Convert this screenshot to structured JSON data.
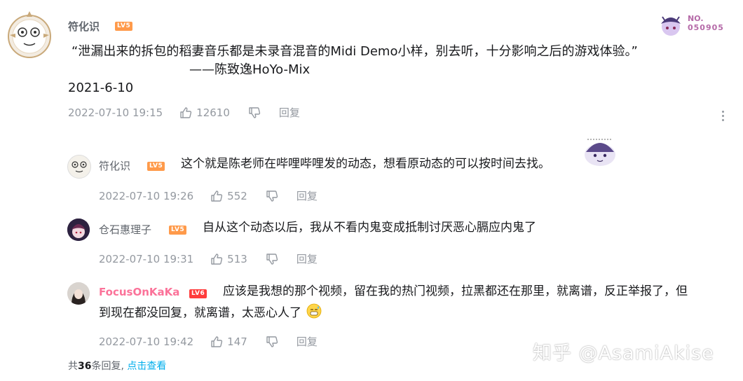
{
  "main_comment": {
    "username": "符化识",
    "level": "LV5",
    "quote_line": "“泄漏出来的拆包的稻妻音乐都是未录音混音的Midi Demo小样，别去听，十分影响之后的游戏体验。”",
    "attribution": "——陈致逸HoYo-Mix",
    "date_line": "2021-6-10",
    "time": "2022-07-10 19:15",
    "likes": "12610",
    "reply_label": "回复",
    "badge_no_label": "NO.",
    "badge_no_value": "050905"
  },
  "replies": [
    {
      "username": "符化识",
      "level": "LV5",
      "text": "这个就是陈老师在哔哩哔哩发的动态，想看原动态的可以按时间去找。",
      "time": "2022-07-10 19:26",
      "likes": "552",
      "reply_label": "回复"
    },
    {
      "username": "仓石惠理子",
      "level": "LV5",
      "text": "自从这个动态以后，我从不看内鬼变成抵制讨厌恶心膈应内鬼了",
      "time": "2022-07-10 19:31",
      "likes": "513",
      "reply_label": "回复"
    },
    {
      "username": "FocusOnKaKa",
      "level": "LV6",
      "text_line1": "应该是我想的那个视频，留在我的热门视频，拉黑都还在那里，就离谱，反正举报了，但",
      "text_line2": "到现在都没回复，就离谱，太恶心人了",
      "time": "2022-07-10 19:42",
      "likes": "147",
      "reply_label": "回复"
    }
  ],
  "footer": {
    "prefix": "共",
    "count": "36",
    "suffix": "条回复,",
    "link": "点击查看"
  },
  "watermark": "知乎 @AsamiAkise",
  "icons": {
    "like": "thumbs-up-icon",
    "dislike": "thumbs-down-icon",
    "more": "more-vertical-icon",
    "emoji": "sweat-emoji-icon"
  },
  "colors": {
    "level_orange": "#ff9a4a",
    "level_red": "#ff3c3c",
    "vip_pink": "#fb7299",
    "link_blue": "#00aeec",
    "meta_gray": "#9499a0"
  }
}
